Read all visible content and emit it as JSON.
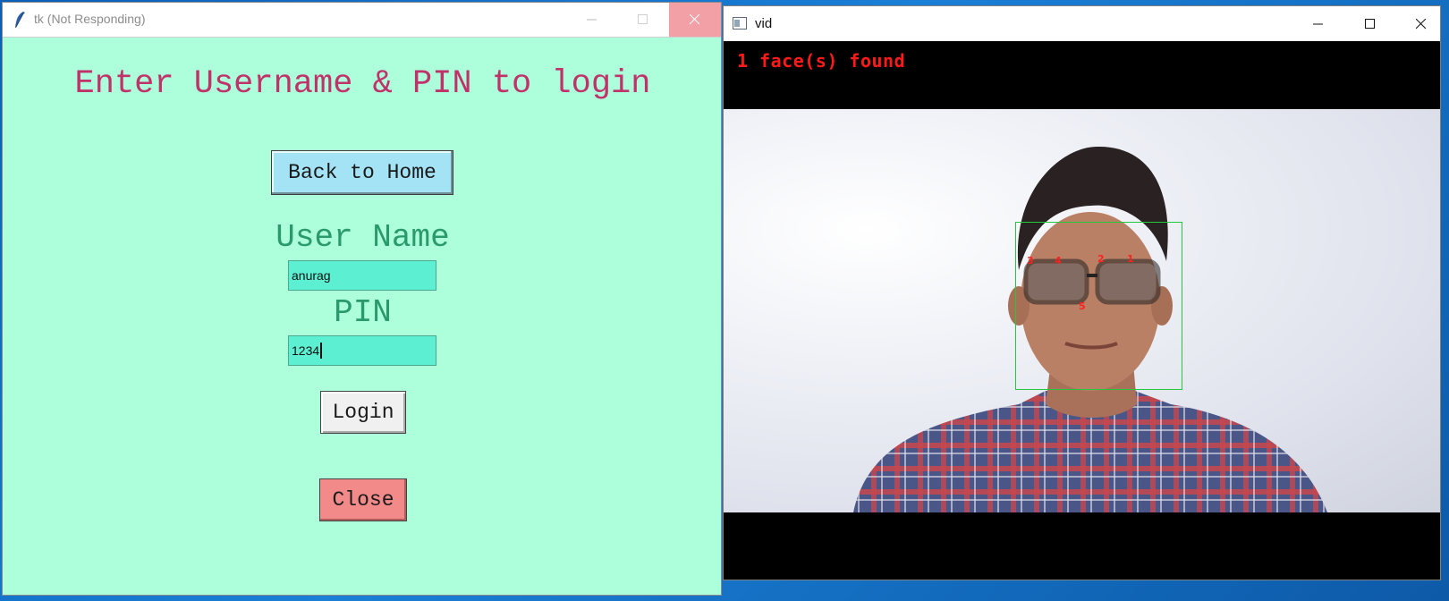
{
  "tk_window": {
    "title": "tk (Not Responding)",
    "heading": "Enter Username & PIN to login",
    "back_button": "Back to Home",
    "username_label": "User Name",
    "username_value": "anurag",
    "pin_label": "PIN",
    "pin_value": "1234",
    "login_button": "Login",
    "close_button": "Close",
    "icons": [
      "feather-icon",
      "minimize-icon",
      "maximize-icon",
      "close-icon"
    ],
    "colors": {
      "background": "#adfedb",
      "heading": "#c0336a",
      "labels": "#2a9a6c",
      "inputs": "#5cefd1",
      "back_button": "#a4e3f5",
      "close_button": "#f38a8a"
    }
  },
  "vid_window": {
    "title": "vid",
    "overlay_text": "1 face(s) found",
    "landmarks": [
      "1",
      "2",
      "3",
      "4",
      "5"
    ],
    "icons": [
      "app-icon",
      "minimize-icon",
      "maximize-icon",
      "close-icon"
    ],
    "colors": {
      "overlay_text": "#ff1a1a",
      "face_box": "#22c93a"
    }
  }
}
